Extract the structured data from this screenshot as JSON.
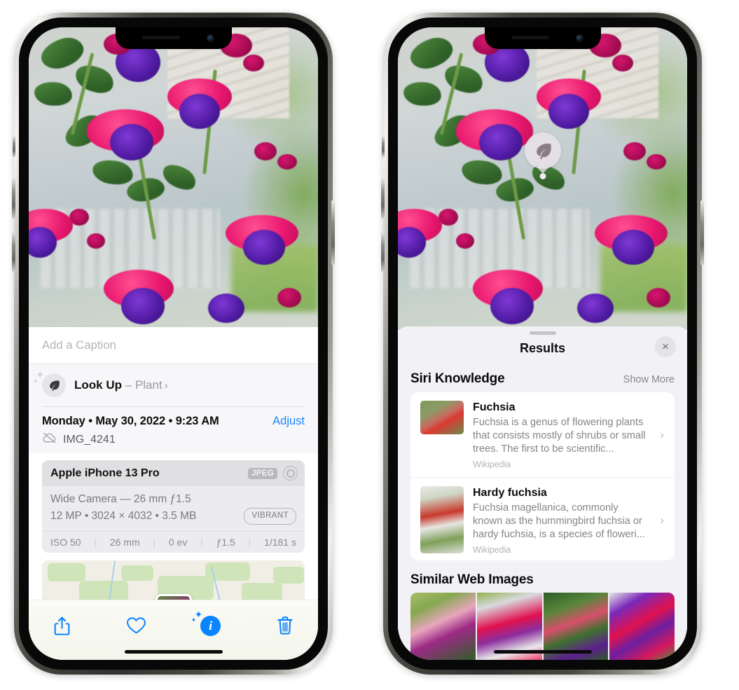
{
  "left_phone": {
    "name": "iphone-photos-info",
    "caption": {
      "placeholder": "Add a Caption",
      "value": ""
    },
    "lookup": {
      "icon": "leaf-icon",
      "label": "Look Up",
      "separator": "–",
      "subject": "Plant",
      "chevron": "›"
    },
    "meta": {
      "date": "Monday • May 30, 2022 • 9:23 AM",
      "adjust_label": "Adjust",
      "cloud_icon": "icloud-slash-icon",
      "filename": "IMG_4241"
    },
    "camera_card": {
      "device": "Apple iPhone 13 Pro",
      "format_badge": "JPEG",
      "raw_icon": "aperture-icon",
      "lens_line": "Wide Camera — 26 mm ƒ1.5",
      "size_line": "12 MP • 3024 × 4032 • 3.5 MB",
      "style_badge": "VIBRANT",
      "exif": [
        "ISO 50",
        "26 mm",
        "0 ev",
        "ƒ1.5",
        "1/181 s"
      ]
    },
    "toolbar": {
      "share_label": "Share",
      "favorite_label": "Favorite",
      "info_label": "Info",
      "delete_label": "Delete"
    }
  },
  "right_phone": {
    "name": "iphone-visual-lookup-results",
    "photo_badge": {
      "icon": "leaf-icon",
      "label": "Plant"
    },
    "sheet": {
      "grabber": "drag-handle",
      "title": "Results",
      "close_label": "×"
    },
    "siri_knowledge": {
      "title": "Siri Knowledge",
      "show_more": "Show More",
      "items": [
        {
          "title": "Fuchsia",
          "description": "Fuchsia is a genus of flowering plants that consists mostly of shrubs or small trees. The first to be scientific...",
          "source": "Wikipedia",
          "chevron": "›"
        },
        {
          "title": "Hardy fuchsia",
          "description": "Fuchsia magellanica, commonly known as the hummingbird fuchsia or hardy fuchsia, is a species of floweri...",
          "source": "Wikipedia",
          "chevron": "›"
        }
      ]
    },
    "similar_web_images": {
      "title": "Similar Web Images",
      "count": 4
    }
  },
  "colors": {
    "accent_blue": "#0a84ff",
    "link_blue": "#1a86ff",
    "sheet_bg": "#f2f1f6",
    "card_bg": "#ffffff",
    "muted_text": "#85858b"
  }
}
